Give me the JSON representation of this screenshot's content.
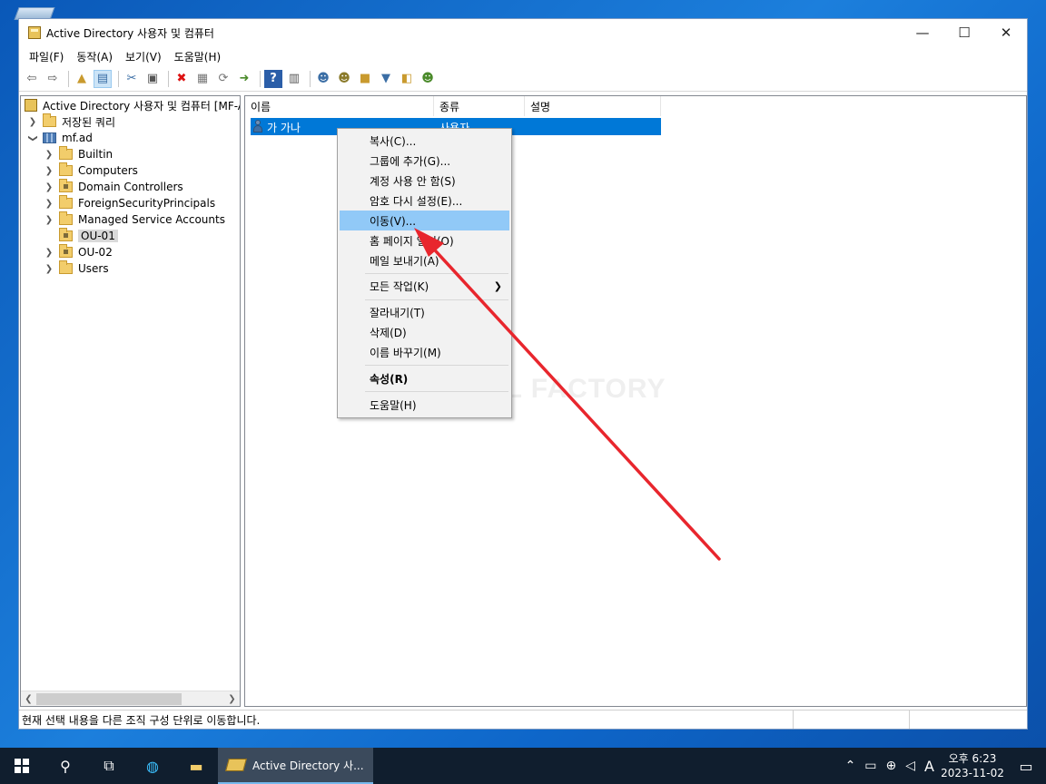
{
  "window": {
    "title": "Active Directory 사용자 및 컴퓨터",
    "controls": {
      "minimize": "—",
      "maximize": "☐",
      "close": "✕"
    }
  },
  "menubar": [
    "파일(F)",
    "동작(A)",
    "보기(V)",
    "도움말(H)"
  ],
  "toolbar": {
    "icons": [
      "back-icon",
      "forward-icon",
      "up-folder-icon",
      "show-hide-tree-icon",
      "cut-icon",
      "copy-icon",
      "delete-icon",
      "properties-icon",
      "refresh-icon",
      "export-icon",
      "help-icon",
      "console-icon",
      "new-user-icon",
      "new-group-icon",
      "new-ou-icon",
      "filter-icon",
      "find-icon",
      "add-to-group-icon"
    ]
  },
  "tree": {
    "root": "Active Directory 사용자 및 컴퓨터 [MF-A",
    "saved_queries": "저장된 쿼리",
    "domain": "mf.ad",
    "children": [
      "Builtin",
      "Computers",
      "Domain Controllers",
      "ForeignSecurityPrincipals",
      "Managed Service Accounts",
      "OU-01",
      "OU-02",
      "Users"
    ],
    "selected": "OU-01"
  },
  "list": {
    "columns": [
      "이름",
      "종류",
      "설명"
    ],
    "rows": [
      {
        "name": "가 가나",
        "type": "사용자",
        "description": ""
      }
    ]
  },
  "context_menu": {
    "copy": "복사(C)...",
    "add_to_group": "그룹에 추가(G)...",
    "disable_account": "계정 사용 안 함(S)",
    "reset_password": "암호 다시 설정(E)...",
    "move": "이동(V)...",
    "open_home_page": "홈 페이지 열기(O)",
    "send_mail": "메일 보내기(A)",
    "all_tasks": "모든 작업(K)",
    "cut": "잘라내기(T)",
    "delete": "삭제(D)",
    "rename": "이름 바꾸기(M)",
    "properties": "속성(R)",
    "help": "도움말(H)",
    "highlighted": "이동(V)..."
  },
  "watermark": "MANUAL FACTORY",
  "statusbar": {
    "text": "현재 선택 내용을 다른 조직 구성 단위로 이동합니다."
  },
  "taskbar": {
    "app_label": "Active Directory 사...",
    "clock_period": "오후 6:23",
    "clock_date": "2023-11-02",
    "ime": "A"
  },
  "colors": {
    "selection": "#0078d7",
    "menu_highlight": "#91c9f7",
    "arrow": "#e8262d",
    "taskbar": "#101e2e"
  }
}
